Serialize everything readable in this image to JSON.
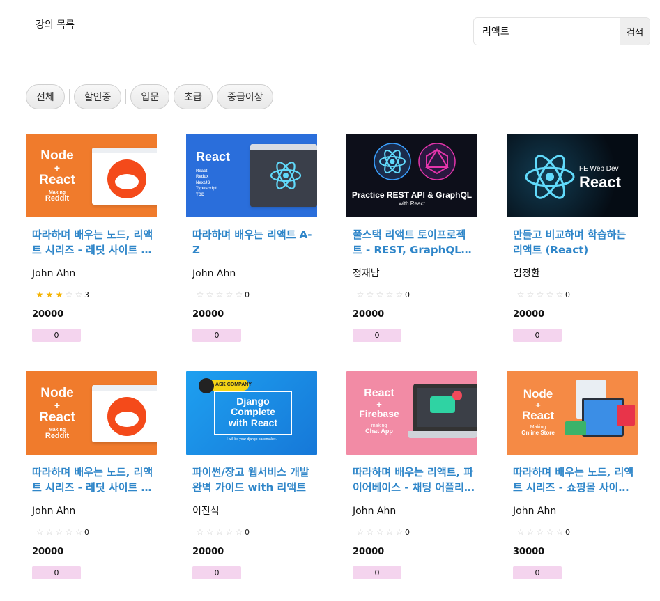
{
  "header": {
    "title": "강의 목록"
  },
  "search": {
    "value": "리액트",
    "button_label": "검색"
  },
  "filters": [
    "전체",
    "할인중",
    "입문",
    "초급",
    "중급이상"
  ],
  "courses": [
    {
      "title": "따라하며 배우는 노드, 리액트 시리즈 - 레딧 사이트 만들기",
      "instructor": "John Ahn",
      "rating": 3,
      "rating_count": "3",
      "price": "20000",
      "discount": "0",
      "thumb": {
        "style": "orange",
        "lines": [
          "Node",
          "+",
          "React",
          "Making",
          "Reddit"
        ]
      }
    },
    {
      "title": "따라하며 배우는 리액트 A-Z",
      "instructor": "John Ahn",
      "rating": 0,
      "rating_count": "0",
      "price": "20000",
      "discount": "0",
      "thumb": {
        "style": "blue",
        "lines": [
          "React",
          "React",
          "Redux",
          "NextJS",
          "Typescript",
          "TDD"
        ]
      }
    },
    {
      "title": "풀스택 리액트 토이프로젝트 - REST, GraphQL (for FE개발자)",
      "instructor": "정재남",
      "rating": 0,
      "rating_count": "0",
      "price": "20000",
      "discount": "0",
      "thumb": {
        "style": "dark",
        "lines": [
          "Practice REST API & GraphQL",
          "with React"
        ]
      }
    },
    {
      "title": "만들고 비교하며 학습하는 리액트 (React)",
      "instructor": "김정환",
      "rating": 0,
      "rating_count": "0",
      "price": "20000",
      "discount": "0",
      "thumb": {
        "style": "navy",
        "lines": [
          "FE Web Dev",
          "React"
        ]
      }
    },
    {
      "title": "따라하며 배우는 노드, 리액트 시리즈 - 레딧 사이트 만들기",
      "instructor": "John Ahn",
      "rating": 0,
      "rating_count": "0",
      "price": "20000",
      "discount": "0",
      "thumb": {
        "style": "orange",
        "lines": [
          "Node",
          "+",
          "React",
          "Making",
          "Reddit"
        ]
      }
    },
    {
      "title": "파이썬/장고 웹서비스 개발 완벽 가이드 with 리액트",
      "instructor": "이진석",
      "rating": 0,
      "rating_count": "0",
      "price": "20000",
      "discount": "0",
      "thumb": {
        "style": "skyblue",
        "lines": [
          "ASK COMPANY",
          "Django",
          "Complete",
          "with React",
          "I will be your django pacemaker."
        ]
      }
    },
    {
      "title": "따라하며 배우는 리액트, 파이어베이스 - 채팅 어플리케이션 만들기",
      "instructor": "John Ahn",
      "rating": 0,
      "rating_count": "0",
      "price": "20000",
      "discount": "0",
      "thumb": {
        "style": "pink",
        "lines": [
          "React",
          "+",
          "Firebase",
          "making",
          "Chat App"
        ]
      }
    },
    {
      "title": "따라하며 배우는 노드, 리액트 시리즈 - 쇼핑몰 사이트 만들기",
      "instructor": "John Ahn",
      "rating": 0,
      "rating_count": "0",
      "price": "30000",
      "discount": "0",
      "thumb": {
        "style": "peach",
        "lines": [
          "Node",
          "+",
          "React",
          "Making",
          "Online Store"
        ]
      }
    }
  ],
  "colors": {
    "title_link": "#2f86c9",
    "star_on": "#f5b301",
    "star_off": "#c8c8c8",
    "discount_badge": "#f4d4ee"
  },
  "icons": {
    "star_filled": "★",
    "star_empty": "☆"
  }
}
